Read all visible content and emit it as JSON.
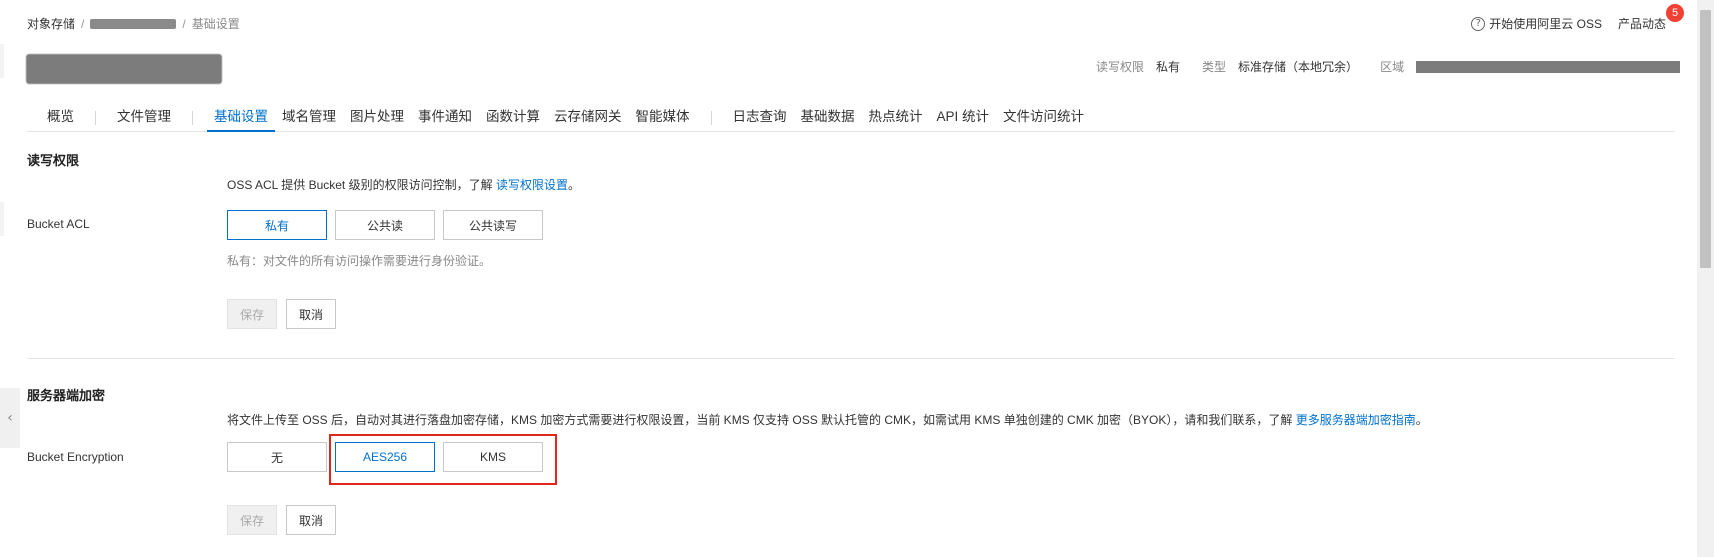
{
  "breadcrumb": {
    "root": "对象存储",
    "separator": "/",
    "current": "基础设置"
  },
  "top_links": {
    "help_icon_glyph": "?",
    "help_label": "开始使用阿里云 OSS",
    "news_label": "产品动态",
    "news_badge": "5"
  },
  "bucket_meta": {
    "acl_label": "读写权限",
    "acl_value": "私有",
    "type_label": "类型",
    "type_value": "标准存储（本地冗余）",
    "region_label": "区域"
  },
  "tabs": [
    {
      "label": "概览"
    },
    {
      "label": "文件管理"
    },
    {
      "label": "基础设置"
    },
    {
      "label": "域名管理"
    },
    {
      "label": "图片处理"
    },
    {
      "label": "事件通知"
    },
    {
      "label": "函数计算"
    },
    {
      "label": "云存储网关"
    },
    {
      "label": "智能媒体"
    },
    {
      "label": "日志查询"
    },
    {
      "label": "基础数据"
    },
    {
      "label": "热点统计"
    },
    {
      "label": "API 统计"
    },
    {
      "label": "文件访问统计"
    }
  ],
  "active_tab": "基础设置",
  "acl_section": {
    "title": "读写权限",
    "desc_prefix": "OSS ACL 提供 Bucket 级别的权限访问控制，了解 ",
    "desc_link": "读写权限设置",
    "desc_suffix": "。",
    "field_label": "Bucket ACL",
    "options": [
      "私有",
      "公共读",
      "公共读写"
    ],
    "selected": "私有",
    "hint": "私有：对文件的所有访问操作需要进行身份验证。",
    "save_label": "保存",
    "cancel_label": "取消"
  },
  "encryption_section": {
    "title": "服务器端加密",
    "desc_prefix": "将文件上传至 OSS 后，自动对其进行落盘加密存储，KMS 加密方式需要进行权限设置，当前 KMS 仅支持 OSS 默认托管的 CMK，如需试用 KMS 单独创建的 CMK 加密（BYOK），请和我们联系，了解 ",
    "desc_link": "更多服务器端加密指南",
    "desc_suffix": "。",
    "field_label": "Bucket Encryption",
    "options": [
      "无",
      "AES256",
      "KMS"
    ],
    "selected": "AES256",
    "save_label": "保存",
    "cancel_label": "取消"
  },
  "colors": {
    "accent": "#0070cc",
    "highlight_box": "#e0261d",
    "badge": "#f04134"
  },
  "collapse_glyph": "‹"
}
